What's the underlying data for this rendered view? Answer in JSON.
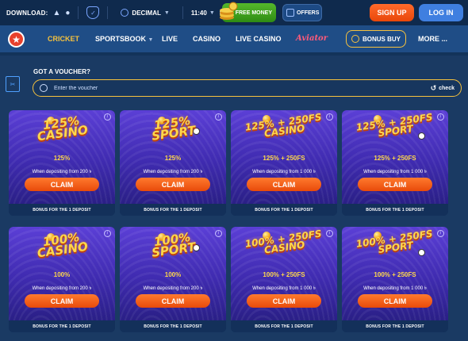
{
  "topbar": {
    "download_label": "DOWNLOAD:",
    "odds_format": "DECIMAL",
    "time": "11:40",
    "free_money_label": "FREE MONEY",
    "offers_label": "OFFERS",
    "signup_label": "SIGN UP",
    "login_label": "LOG IN"
  },
  "nav": {
    "items": [
      "CRICKET",
      "SPORTSBOOK",
      "LIVE",
      "CASINO",
      "LIVE CASINO",
      "Aviator"
    ],
    "bonus_buy": "BONUS BUY",
    "more": "MORE ..."
  },
  "voucher": {
    "title": "GOT A VOUCHER?",
    "placeholder": "Enter the voucher",
    "check_label": "check"
  },
  "cards": [
    {
      "title": "125%\nCASINO",
      "amount": "125%",
      "depositing": "When depositing from 200 ৳",
      "claim": "CLAIM",
      "footer": "BONUS FOR THE 1 DEPOSIT"
    },
    {
      "title": "125%\nSPORT",
      "amount": "125%",
      "depositing": "When depositing from 200 ৳",
      "claim": "CLAIM",
      "footer": "BONUS FOR THE 1 DEPOSIT"
    },
    {
      "title": "125% + 250FS\nCASINO",
      "amount": "125% + 250FS",
      "depositing": "When depositing from 1 000 ৳",
      "claim": "CLAIM",
      "footer": "BONUS FOR THE 1 DEPOSIT"
    },
    {
      "title": "125% + 250FS\nSPORT",
      "amount": "125% + 250FS",
      "depositing": "When depositing from 1 000 ৳",
      "claim": "CLAIM",
      "footer": "BONUS FOR THE 1 DEPOSIT"
    },
    {
      "title": "100%\nCASINO",
      "amount": "100%",
      "depositing": "When depositing from 200 ৳",
      "claim": "CLAIM",
      "footer": "BONUS FOR THE 1 DEPOSIT"
    },
    {
      "title": "100%\nSPORT",
      "amount": "100%",
      "depositing": "When depositing from 200 ৳",
      "claim": "CLAIM",
      "footer": "BONUS FOR THE 1 DEPOSIT"
    },
    {
      "title": "100% + 250FS\nCASINO",
      "amount": "100% + 250FS",
      "depositing": "When depositing from 1 000 ৳",
      "claim": "CLAIM",
      "footer": "BONUS FOR THE 1 DEPOSIT"
    },
    {
      "title": "100% + 250FS\nSPORT",
      "amount": "100% + 250FS",
      "depositing": "When depositing from 1 000 ৳",
      "claim": "CLAIM",
      "footer": "BONUS FOR THE 1 DEPOSIT"
    }
  ],
  "colors": {
    "accent_yellow": "#f6c23e",
    "signup_orange": "#e9470a",
    "login_blue": "#3f7fe0",
    "card_purple": "#4a33c4"
  },
  "icons": [
    "android-icon",
    "apple-icon",
    "shield-icon",
    "odds-icon",
    "uk-flag-icon",
    "coins-icon",
    "gift-icon",
    "logo-star-icon",
    "voucher-icon",
    "check-icon",
    "info-icon"
  ]
}
